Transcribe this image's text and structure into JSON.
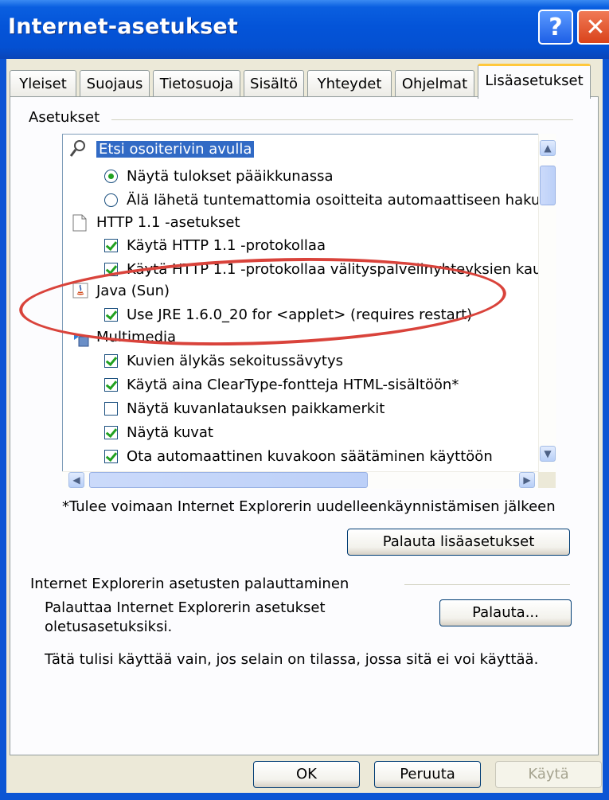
{
  "window": {
    "title": "Internet-asetukset",
    "help_glyph": "?",
    "close_glyph": "✕"
  },
  "tabs": [
    "Yleiset",
    "Suojaus",
    "Tietosuoja",
    "Sisältö",
    "Yhteydet",
    "Ohjelmat",
    "Lisäasetukset"
  ],
  "active_tab": "Lisäasetukset",
  "settings": {
    "group_label": "Asetukset",
    "items": [
      {
        "kind": "category",
        "icon": "magnifier-icon",
        "label": "Etsi osoiterivin avulla",
        "selected": true
      },
      {
        "kind": "radio",
        "checked": true,
        "label": "Näytä tulokset pääikkunassa"
      },
      {
        "kind": "radio",
        "checked": false,
        "label": "Älä lähetä tuntemattomia osoitteita automaattiseen hakup"
      },
      {
        "kind": "category",
        "icon": "page-icon",
        "label": "HTTP 1.1 -asetukset"
      },
      {
        "kind": "checkbox",
        "checked": true,
        "label": "Käytä HTTP 1.1 -protokollaa"
      },
      {
        "kind": "checkbox",
        "checked": true,
        "label": "Käytä HTTP 1.1 -protokollaa välityspalvelinyhteyksien kau"
      },
      {
        "kind": "category",
        "icon": "java-icon",
        "label": "Java (Sun)"
      },
      {
        "kind": "checkbox",
        "checked": true,
        "label": "Use JRE 1.6.0_20 for <applet> (requires restart)"
      },
      {
        "kind": "category",
        "icon": "multimedia-icon",
        "label": "Multimedia"
      },
      {
        "kind": "checkbox",
        "checked": true,
        "label": "Kuvien älykäs sekoitussävytys"
      },
      {
        "kind": "checkbox",
        "checked": true,
        "label": "Käytä aina ClearType-fontteja HTML-sisältöön*"
      },
      {
        "kind": "checkbox",
        "checked": false,
        "label": "Näytä kuvanlatauksen paikkamerkit"
      },
      {
        "kind": "checkbox",
        "checked": true,
        "label": "Näytä kuvat"
      },
      {
        "kind": "checkbox",
        "checked": true,
        "label": "Ota automaattinen kuvakoon säätäminen käyttöön"
      }
    ],
    "footnote": "*Tulee voimaan Internet Explorerin uudelleenkäynnistämisen jälkeen",
    "restore_advanced_button": "Palauta lisäasetukset"
  },
  "reset": {
    "group_label": "Internet Explorerin asetusten palauttaminen",
    "description_line1": "Palauttaa Internet Explorerin asetukset",
    "description_line2": "oletusasetuksiksi.",
    "button": "Palauta...",
    "warning": "Tätä tulisi käyttää vain, jos selain on tilassa, jossa sitä ei voi käyttää."
  },
  "buttons": {
    "ok": "OK",
    "cancel": "Peruuta",
    "apply": "Käytä"
  },
  "colors": {
    "titlebar": "#0454d8",
    "dialog": "#ece9d8",
    "selection": "#316ac5",
    "annotation": "#d9433b",
    "check": "#21a121"
  }
}
